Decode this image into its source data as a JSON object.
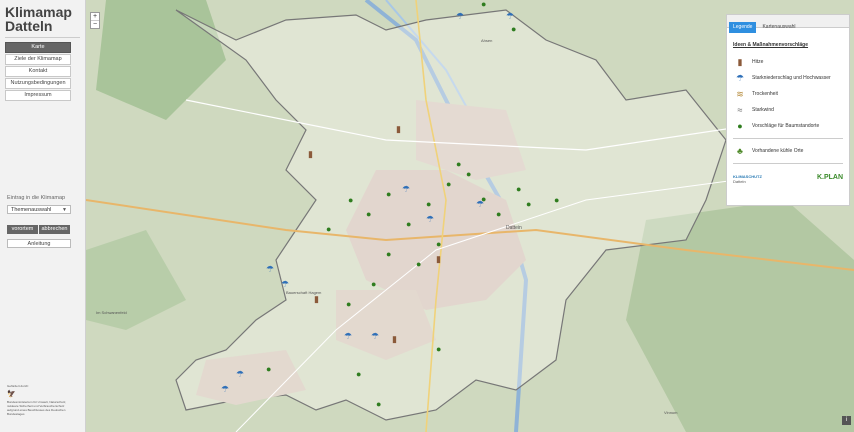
{
  "app_title_line1": "Klimamap",
  "app_title_line2": "Datteln",
  "nav": [
    "Karte",
    "Ziele der Klimamap",
    "Kontakt",
    "Nutzungsbedingungen",
    "Impressum"
  ],
  "entry": {
    "heading": "Eintrag in die Klimamap",
    "select_value": "Themenauswahl",
    "btn_save": "vorortem",
    "btn_cancel": "abbrechen",
    "guide": "Anleitung"
  },
  "funder": {
    "line1": "Gefördert durch:",
    "line2": "Bundesministerium für Umwelt, Naturschutz, nukleare Sicherheit und Verbraucherschutz",
    "line3": "aufgrund eines Beschlusses des Deutschen Bundestages"
  },
  "legend": {
    "tab_active": "Legende",
    "tab_other": "Kartenauswahl",
    "heading": "Ideen & Maßnahmenvorschläge",
    "items": [
      {
        "label": "Hitze",
        "icon": "thermometer-icon"
      },
      {
        "label": "Starkniederschlag und Hochwasser",
        "icon": "umbrella-icon"
      },
      {
        "label": "Trockenheit",
        "icon": "drought-icon"
      },
      {
        "label": "Starkwind",
        "icon": "wind-icon"
      },
      {
        "label": "Vorschläge für Baumstandorte",
        "icon": "tree-icon"
      }
    ],
    "extra": {
      "label": "Vorhandene kühle Orte",
      "icon": "cool-place-icon"
    },
    "logo1": "KLIMASCHUTZ",
    "logo1_sub": "Datteln",
    "logo2": "K.PLAN"
  },
  "map_labels": {
    "place1": "Bauerschaft Hagem",
    "place2": "Ahsen",
    "place3": "Dattein",
    "place4": "Vinnum",
    "place5": "Im Schwanenfeld"
  },
  "colors": {
    "sidebar_active": "#666666",
    "legend_tab": "#2f8fe0",
    "tree": "#2f7d1f",
    "umbrella": "#2e6fb8",
    "boundary": "#777777"
  }
}
